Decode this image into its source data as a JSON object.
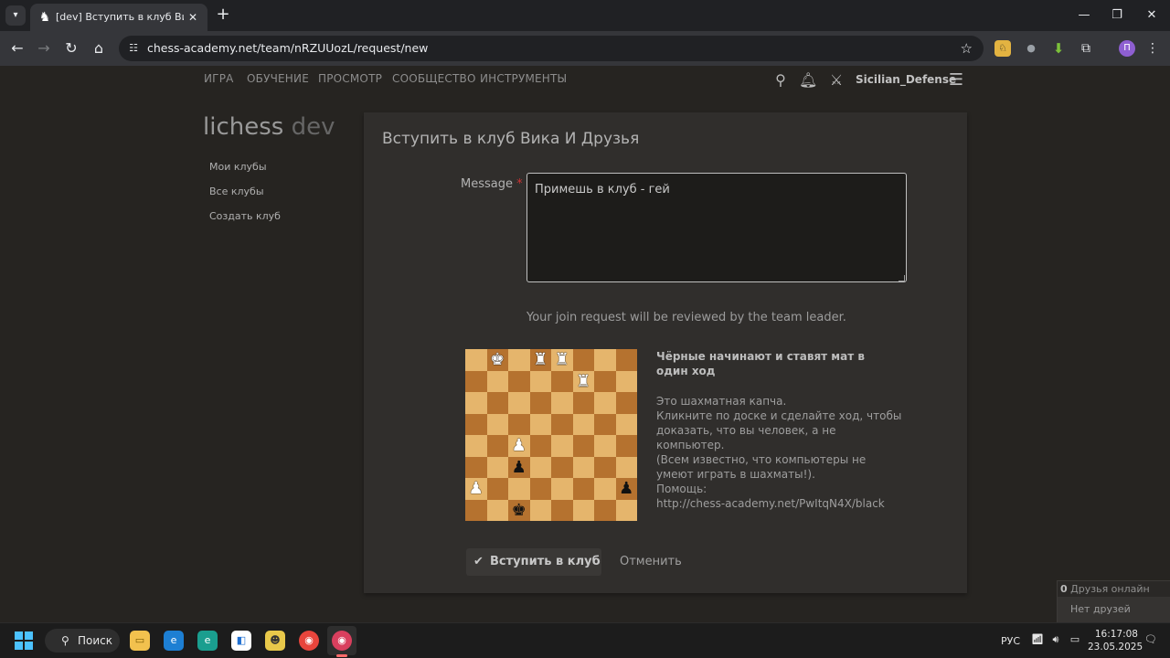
{
  "browser": {
    "tab_title": "[dev] Вступить в клуб Вика И Друзья",
    "url": "chess-academy.net/team/nRZUUozL/request/new",
    "profile_initial": "П",
    "icons": {
      "tab_search": "chevron-down-icon",
      "favicon": "knight-icon",
      "close": "close-icon",
      "new_tab": "plus-icon",
      "back": "arrow-left-icon",
      "forward": "arrow-right-icon",
      "reload": "reload-icon",
      "home": "home-icon",
      "site_info": "tune-icon",
      "bookmark": "star-icon"
    }
  },
  "site": {
    "nav": [
      "ИГРА",
      "ОБУЧЕНИЕ",
      "ПРОСМОТР",
      "СООБЩЕСТВО",
      "ИНСТРУМЕНТЫ"
    ],
    "username": "Sicilian_Defense",
    "logo_main": "lichess",
    "logo_suffix": " dev"
  },
  "sidebar": {
    "items": [
      {
        "label": "Мои клубы"
      },
      {
        "label": "Все клубы"
      },
      {
        "label": "Создать клуб"
      }
    ]
  },
  "form": {
    "title": "Вступить в клуб Вика И Друзья",
    "message_label": "Message",
    "required_mark": "*",
    "message_value": "Примешь в клуб - гей",
    "hint": "Your join request will be reviewed by the team leader.",
    "submit_label": "Вступить в клуб",
    "cancel_label": "Отменить"
  },
  "captcha": {
    "title": "Чёрные начинают и ставят мат в один ход",
    "line1": "Это шахматная капча.",
    "line2": "Кликните по доске и сделайте ход, чтобы доказать, что вы человек, а не компьютер.",
    "line3": "(Всем известно, что компьютеры не умеют играть в шахматы!).",
    "help_label": "Помощь:",
    "help_url": "http://chess-academy.net/PwItqN4X/black",
    "board_ranks": [
      " K RR   ",
      "     R  ",
      "        ",
      "        ",
      "  P     ",
      "  p     ",
      "P      p",
      "  k     "
    ]
  },
  "friends": {
    "count": "0",
    "online_label": " Друзья онлайн",
    "empty_label": "Нет друзей онлайн"
  },
  "taskbar": {
    "search_label": "Поиск",
    "lang": "РУС",
    "time": "16:17:08",
    "date": "23.05.2025"
  }
}
